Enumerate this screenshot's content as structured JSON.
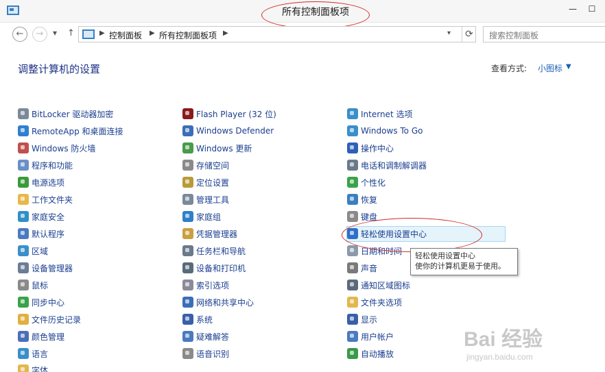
{
  "window": {
    "title": "所有控制面板项",
    "minimize": "—",
    "maximize": "☐"
  },
  "nav": {
    "back": "←",
    "forward": "→",
    "dropdown": "▾",
    "up": "↑",
    "breadcrumb": [
      "控制面板",
      "所有控制面板项"
    ],
    "crumb_separator": "▶",
    "address_dropdown": "▾",
    "refresh": "⟳",
    "search_placeholder": "搜索控制面板"
  },
  "main": {
    "heading": "调整计算机的设置",
    "view_by_label": "查看方式:",
    "view_by_value": "小图标",
    "view_by_caret": "▼"
  },
  "columns": [
    [
      {
        "label": "BitLocker 驱动器加密",
        "icon": "bitlocker-icon",
        "color": "#7a8a99"
      },
      {
        "label": "RemoteApp 和桌面连接",
        "icon": "remoteapp-icon",
        "color": "#2f7fd1"
      },
      {
        "label": "Windows 防火墙",
        "icon": "firewall-icon",
        "color": "#c0504d"
      },
      {
        "label": "程序和功能",
        "icon": "programs-icon",
        "color": "#6b8fc7"
      },
      {
        "label": "电源选项",
        "icon": "power-icon",
        "color": "#3a9a3a"
      },
      {
        "label": "工作文件夹",
        "icon": "work-folders-icon",
        "color": "#e8b84a"
      },
      {
        "label": "家庭安全",
        "icon": "family-safety-icon",
        "color": "#2f8fc9"
      },
      {
        "label": "默认程序",
        "icon": "default-programs-icon",
        "color": "#4a7bc2"
      },
      {
        "label": "区域",
        "icon": "region-icon",
        "color": "#3a8fc9"
      },
      {
        "label": "设备管理器",
        "icon": "device-manager-icon",
        "color": "#6a7d95"
      },
      {
        "label": "鼠标",
        "icon": "mouse-icon",
        "color": "#8a8a8a"
      },
      {
        "label": "同步中心",
        "icon": "sync-center-icon",
        "color": "#3aa34a"
      },
      {
        "label": "文件历史记录",
        "icon": "file-history-icon",
        "color": "#e0b040"
      },
      {
        "label": "颜色管理",
        "icon": "color-management-icon",
        "color": "#4a6fb8"
      },
      {
        "label": "语言",
        "icon": "language-icon",
        "color": "#3a8fc9"
      },
      {
        "label": "字体",
        "icon": "fonts-icon",
        "color": "#e2b84e"
      }
    ],
    [
      {
        "label": "Flash Player (32 位)",
        "icon": "flash-icon",
        "color": "#8b1a1a"
      },
      {
        "label": "Windows Defender",
        "icon": "defender-icon",
        "color": "#3a6fb8"
      },
      {
        "label": "Windows 更新",
        "icon": "windows-update-icon",
        "color": "#4a9a4a"
      },
      {
        "label": "存储空间",
        "icon": "storage-spaces-icon",
        "color": "#8a8a8a"
      },
      {
        "label": "定位设置",
        "icon": "location-icon",
        "color": "#b89a3a"
      },
      {
        "label": "管理工具",
        "icon": "admin-tools-icon",
        "color": "#7a8a9a"
      },
      {
        "label": "家庭组",
        "icon": "homegroup-icon",
        "color": "#2f7fc9"
      },
      {
        "label": "凭据管理器",
        "icon": "credential-icon",
        "color": "#c9a040"
      },
      {
        "label": "任务栏和导航",
        "icon": "taskbar-icon",
        "color": "#6a7a8a"
      },
      {
        "label": "设备和打印机",
        "icon": "printer-icon",
        "color": "#5a6a7a"
      },
      {
        "label": "索引选项",
        "icon": "indexing-icon",
        "color": "#8a8a9a"
      },
      {
        "label": "网络和共享中心",
        "icon": "network-icon",
        "color": "#3a6fb8"
      },
      {
        "label": "系统",
        "icon": "system-icon",
        "color": "#3a5fa8"
      },
      {
        "label": "疑难解答",
        "icon": "troubleshoot-icon",
        "color": "#4a7ac0"
      },
      {
        "label": "语音识别",
        "icon": "speech-icon",
        "color": "#8a8a8a"
      }
    ],
    [
      {
        "label": "Internet 选项",
        "icon": "internet-options-icon",
        "color": "#3a8fc9"
      },
      {
        "label": "Windows To Go",
        "icon": "windows-to-go-icon",
        "color": "#3a8fc9"
      },
      {
        "label": "操作中心",
        "icon": "action-center-icon",
        "color": "#2f5fb8"
      },
      {
        "label": "电话和调制解调器",
        "icon": "phone-modem-icon",
        "color": "#6a7a8a"
      },
      {
        "label": "个性化",
        "icon": "personalization-icon",
        "color": "#3aa34a"
      },
      {
        "label": "恢复",
        "icon": "recovery-icon",
        "color": "#3a7fc1"
      },
      {
        "label": "键盘",
        "icon": "keyboard-icon",
        "color": "#8a8a8a"
      },
      {
        "label": "轻松使用设置中心",
        "icon": "ease-of-access-icon",
        "color": "#2f6fc9"
      },
      {
        "label": "日期和时间",
        "icon": "date-time-icon",
        "color": "#8a9aaa"
      },
      {
        "label": "声音",
        "icon": "sound-icon",
        "color": "#7a7a7a"
      },
      {
        "label": "通知区域图标",
        "icon": "notification-icons-icon",
        "color": "#5a6a7a"
      },
      {
        "label": "文件夹选项",
        "icon": "folder-options-icon",
        "color": "#e2b84e"
      },
      {
        "label": "显示",
        "icon": "display-icon",
        "color": "#3a5fa8"
      },
      {
        "label": "用户帐户",
        "icon": "user-accounts-icon",
        "color": "#4a7ac0"
      },
      {
        "label": "自动播放",
        "icon": "autoplay-icon",
        "color": "#3a9a4a"
      }
    ]
  ],
  "tooltip": {
    "title": "轻松使用设置中心",
    "text": "使你的计算机更易于使用。"
  },
  "watermark": {
    "brand": "Bai 经验",
    "url": "jingyan.baidu.com"
  }
}
